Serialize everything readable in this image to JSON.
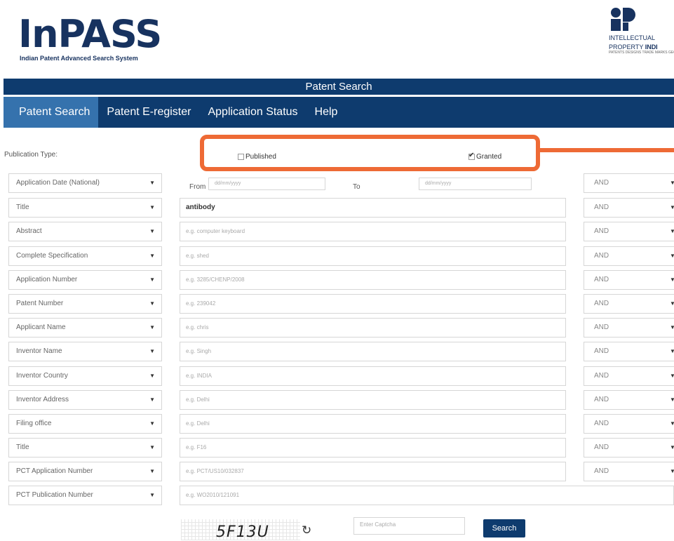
{
  "header": {
    "logo_text": "InPASS",
    "logo_subtitle": "Indian Patent Advanced Search System",
    "ip_logo_line1": "INTELLECTUAL",
    "ip_logo_line2a": "PROPERTY ",
    "ip_logo_line2b": "INDI",
    "ip_logo_tiny": "PATENTS DESIGNS TRADE MARKS GEOGRAPHICAL INDICATIONS"
  },
  "title_bar": "Patent Search",
  "nav": {
    "items": [
      {
        "label": "Patent Search",
        "active": true
      },
      {
        "label": "Patent E-register",
        "active": false
      },
      {
        "label": "Application Status",
        "active": false
      },
      {
        "label": "Help",
        "active": false
      }
    ]
  },
  "publication": {
    "label": "Publication Type:",
    "published": {
      "label": "Published",
      "checked": false
    },
    "granted": {
      "label": "Granted",
      "checked": true
    }
  },
  "date_row": {
    "field": "Application Date (National)",
    "from_label": "From",
    "from_placeholder": "dd/mm/yyyy",
    "to_label": "To",
    "to_placeholder": "dd/mm/yyyy",
    "operator": "AND"
  },
  "rows": [
    {
      "field": "Title",
      "value": "antibody",
      "placeholder": "",
      "operator": "AND"
    },
    {
      "field": "Abstract",
      "value": "",
      "placeholder": "e.g. computer keyboard",
      "operator": "AND"
    },
    {
      "field": "Complete Specification",
      "value": "",
      "placeholder": "e.g. shed",
      "operator": "AND"
    },
    {
      "field": "Application Number",
      "value": "",
      "placeholder": "e.g. 3285/CHENP/2008",
      "operator": "AND"
    },
    {
      "field": "Patent Number",
      "value": "",
      "placeholder": "e.g. 239042",
      "operator": "AND"
    },
    {
      "field": "Applicant Name",
      "value": "",
      "placeholder": "e.g. chris",
      "operator": "AND"
    },
    {
      "field": "Inventor Name",
      "value": "",
      "placeholder": "e.g. Singh",
      "operator": "AND"
    },
    {
      "field": "Inventor Country",
      "value": "",
      "placeholder": "e.g. INDIA",
      "operator": "AND"
    },
    {
      "field": "Inventor Address",
      "value": "",
      "placeholder": "e.g. Delhi",
      "operator": "AND"
    },
    {
      "field": "Filing office",
      "value": "",
      "placeholder": "e.g. Delhi",
      "operator": "AND"
    },
    {
      "field": "Title",
      "value": "",
      "placeholder": "e.g. F16",
      "operator": "AND"
    },
    {
      "field": "PCT Application Number",
      "value": "",
      "placeholder": "e.g. PCT/US10/032837",
      "operator": "AND"
    },
    {
      "field": "PCT Publication Number",
      "value": "",
      "placeholder": "e.g. WO2010/121091",
      "operator": ""
    }
  ],
  "captcha": {
    "text": "5F13U",
    "refresh_icon": "↻",
    "input_placeholder": "Enter Captcha",
    "search_label": "Search"
  },
  "colors": {
    "nav_bg": "#0e3b6e",
    "nav_active": "#3572ad",
    "highlight": "#ee6a35"
  }
}
